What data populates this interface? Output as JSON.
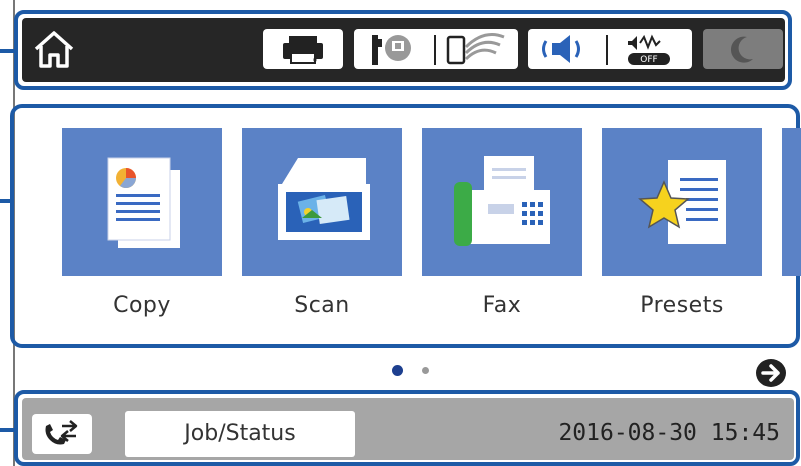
{
  "header": {
    "home_icon": "home-icon",
    "status_icons": [
      "printer-icon",
      "memory-device-icon",
      "wifi-direct-icon",
      "speaker-icon",
      "quiet-mode-off-icon",
      "sleep-moon-icon"
    ],
    "quiet_badge": "OFF"
  },
  "main": {
    "tiles": [
      {
        "label": "Copy",
        "icon": "copy-document-icon"
      },
      {
        "label": "Scan",
        "icon": "scanner-icon"
      },
      {
        "label": "Fax",
        "icon": "fax-machine-icon"
      },
      {
        "label": "Presets",
        "icon": "star-document-icon"
      }
    ],
    "page_indicator": {
      "current": 1,
      "total": 2
    }
  },
  "footer": {
    "fax_icon": "fax-transfer-icon",
    "job_status_label": "Job/Status",
    "datetime": "2016-08-30 15:45"
  },
  "colors": {
    "accent_frame": "#1d5aa6",
    "tile_blue": "#5b82c6",
    "topbar_bg": "#262626",
    "bottombar_bg": "#a6a6a6"
  }
}
